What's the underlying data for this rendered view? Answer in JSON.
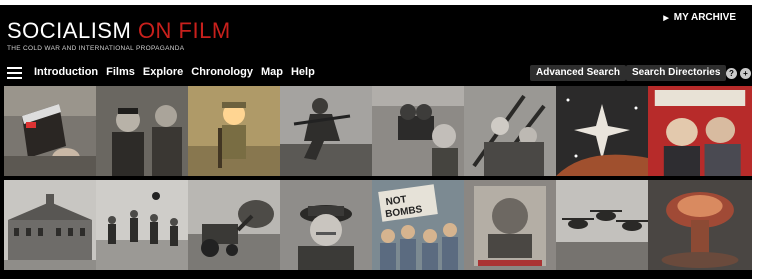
{
  "header": {
    "title_main": "SOCIALISM",
    "title_accent": "ON FILM",
    "subtitle": "THE COLD WAR AND INTERNATIONAL PROPAGANDA",
    "archive_link": "MY ARCHIVE",
    "archive_icon": "triangle-right-icon"
  },
  "nav": {
    "menu_icon": "hamburger-menu-icon",
    "items": [
      "Introduction",
      "Films",
      "Explore",
      "Chronology",
      "Map",
      "Help"
    ],
    "advanced_search": "Advanced Search",
    "search_directories": "Search Directories",
    "help_icon": "question-circle-icon",
    "add_icon": "plus-circle-icon",
    "help_symbol": "?",
    "add_symbol": "+"
  },
  "colors": {
    "background": "#000000",
    "accent": "#c8201c",
    "button": "#2e2e2e",
    "text": "#ffffff"
  },
  "gallery": {
    "row1": [
      "film-clapperboard",
      "revolutionary-leaders",
      "child-soldier",
      "soldier-running",
      "film-cameraman",
      "soldiers-with-rifles",
      "space-stars",
      "magazine-cover"
    ],
    "row2": [
      "palace-building",
      "football-players",
      "tractor-field",
      "officer-portrait",
      "protest-not-bombs",
      "leader-poster",
      "helicopters",
      "mushroom-cloud"
    ]
  }
}
